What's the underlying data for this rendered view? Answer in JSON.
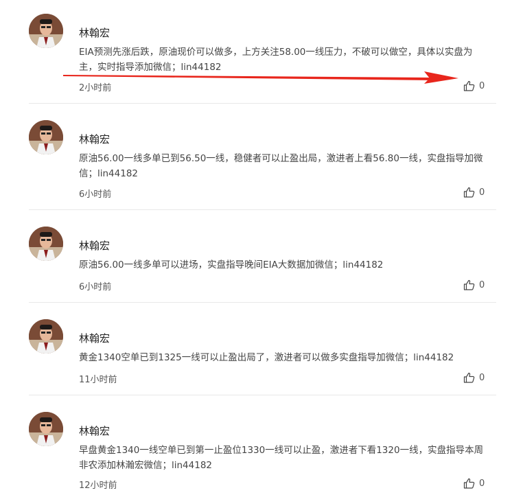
{
  "colors": {
    "divider": "#e8e8e8",
    "arrow": "#e8261c",
    "text": "#444444",
    "author": "#222222"
  },
  "icons": {
    "avatar": "avatar",
    "like": "thumbs-up-icon",
    "annotation": "red-arrow"
  },
  "comments": [
    {
      "author": "林翰宏",
      "text_line1": "EIA预测先涨后跌，原油现价可以做多，上方关注58.00一线压力，不破可以做空，具体以实盘为",
      "text_line2": "主，实时指导添加微信；lin44182",
      "time": "2小时前",
      "likes": "0"
    },
    {
      "author": "林翰宏",
      "text_line1": "原油56.00一线多单已到56.50一线，稳健者可以止盈出局，激进者上看56.80一线，实盘指导加微",
      "text_line2": "信；lin44182",
      "time": "6小时前",
      "likes": "0"
    },
    {
      "author": "林翰宏",
      "text_line1": "原油56.00一线多单可以进场，实盘指导晚间EIA大数据加微信；lin44182",
      "text_line2": "",
      "time": "6小时前",
      "likes": "0"
    },
    {
      "author": "林翰宏",
      "text_line1": "黄金1340空单已到1325一线可以止盈出局了，激进者可以做多实盘指导加微信；lin44182",
      "text_line2": "",
      "time": "11小时前",
      "likes": "0"
    },
    {
      "author": "林翰宏",
      "text_line1": "早盘黄金1340一线空单已到第一止盈位1330一线可以止盈，激进者下看1320一线，实盘指导本周",
      "text_line2": "非农添加林瀚宏微信；lin44182",
      "time": "12小时前",
      "likes": "0"
    }
  ]
}
